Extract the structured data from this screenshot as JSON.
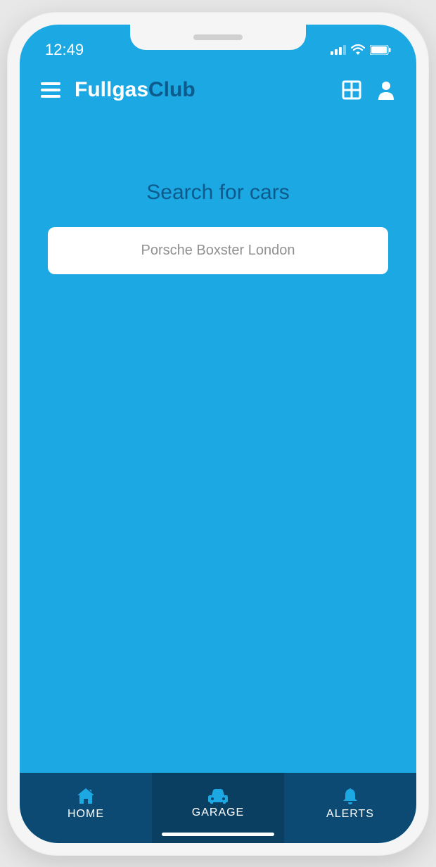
{
  "status": {
    "time": "12:49"
  },
  "header": {
    "logo_part1": "Fullgas",
    "logo_part2": "Club"
  },
  "content": {
    "search_title": "Search for cars",
    "search_placeholder": "Porsche Boxster London"
  },
  "nav": {
    "home": "HOME",
    "garage": "GARAGE",
    "alerts": "ALERTS"
  }
}
